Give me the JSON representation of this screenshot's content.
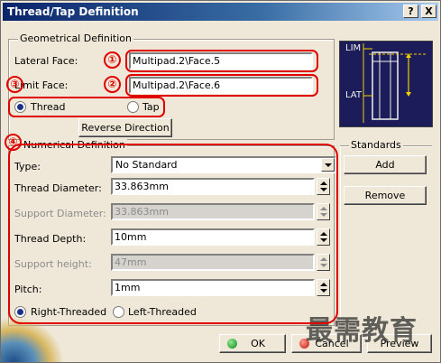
{
  "window": {
    "title": "Thread/Tap Definition",
    "help_label": "?",
    "close_label": "X"
  },
  "geometrical": {
    "title": "Geometrical Definition",
    "lateral_face_label": "Lateral Face:",
    "lateral_face_value": "Multipad.2\\Face.5",
    "limit_face_label": "Limit Face:",
    "limit_face_value": "Multipad.2\\Face.6",
    "thread_label": "Thread",
    "tap_label": "Tap",
    "selected": "thread",
    "reverse_label": "Reverse Direction"
  },
  "numerical": {
    "title": "Numerical Definition",
    "type_label": "Type:",
    "type_value": "No Standard",
    "thread_diameter_label": "Thread Diameter:",
    "thread_diameter_value": "33.863mm",
    "support_diameter_label": "Support Diameter:",
    "support_diameter_value": "33.863mm",
    "thread_depth_label": "Thread Depth:",
    "thread_depth_value": "10mm",
    "support_height_label": "Support height:",
    "support_height_value": "47mm",
    "pitch_label": "Pitch:",
    "pitch_value": "1mm",
    "right_threaded_label": "Right-Threaded",
    "left_threaded_label": "Left-Threaded",
    "handedness": "right"
  },
  "standards": {
    "title": "Standards",
    "add_label": "Add",
    "remove_label": "Remove"
  },
  "diagram": {
    "lim_label": "LIM",
    "lat_label": "LAT"
  },
  "footer": {
    "ok_label": "OK",
    "cancel_label": "Cancel",
    "preview_label": "Preview"
  },
  "annotations": [
    "①",
    "②",
    "③",
    "④"
  ],
  "watermark": "最需教育",
  "colors": {
    "title_bar": "#0a246a",
    "dialog_bg": "#efe8d8",
    "annotation_red": "#e00000",
    "diagram_bg": "#1c1c5a",
    "diagram_lines": "#f0d000"
  }
}
